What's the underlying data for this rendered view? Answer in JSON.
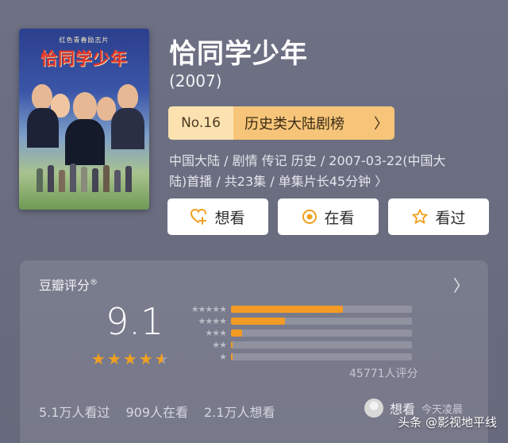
{
  "poster": {
    "subtitle": "红色青春励志片",
    "title": "恰同学少年"
  },
  "movie": {
    "title": "恰同学少年",
    "year": "(2007)"
  },
  "rank": {
    "number": "No.16",
    "label": "历史类大陆剧榜",
    "chevron": "〉"
  },
  "meta": {
    "line1": "中国大陆 / 剧情 传记 历史 / 2007-03-22(中国大",
    "line2": "陆)首播 / 共23集 / 单集片长45分钟 〉"
  },
  "actions": {
    "want": {
      "label": "想看",
      "icon": "heart-plus-icon"
    },
    "watching": {
      "label": "在看",
      "icon": "target-icon"
    },
    "watched": {
      "label": "看过",
      "icon": "star-icon"
    }
  },
  "rating": {
    "header": "豆瓣评分",
    "reg_mark": "®",
    "header_arrow": "〉",
    "score": "9.1",
    "stars_value": 4.5,
    "distribution": [
      {
        "stars": "★★★★★",
        "percent": 62
      },
      {
        "stars": "★★★★",
        "percent": 30
      },
      {
        "stars": "★★★",
        "percent": 6
      },
      {
        "stars": "★★",
        "percent": 1
      },
      {
        "stars": "★",
        "percent": 1
      }
    ],
    "count": "45771人评分",
    "stats": {
      "watched": "5.1万人看过",
      "watching": "909人在看",
      "want": "2.1万人想看"
    },
    "friend": {
      "verb": "想看",
      "time": "今天凌晨"
    }
  },
  "watermark": "头条 @影视地平线",
  "colors": {
    "accent": "#f39b24",
    "rank_bg": "#f6c57a",
    "background": "#6c6f82"
  }
}
